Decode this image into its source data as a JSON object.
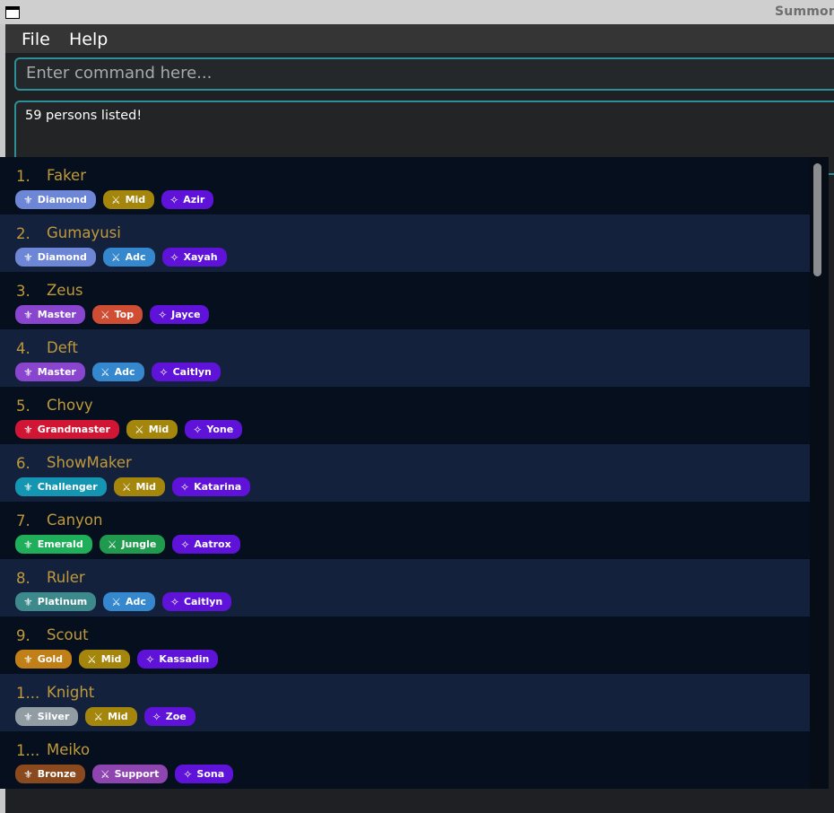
{
  "window": {
    "title": "Summon"
  },
  "menu": [
    {
      "label": "File"
    },
    {
      "label": "Help"
    }
  ],
  "command": {
    "placeholder": "Enter command here...",
    "value": ""
  },
  "result": {
    "text": "59 persons listed!"
  },
  "icons": {
    "rank": "fleur-de-lis-icon",
    "role": "crossed-swords-icon",
    "champion": "sparkle-icon"
  },
  "colors": {
    "rank": {
      "Diamond": "#6d86d6",
      "Master": "#8a45cf",
      "Grandmaster": "#d01535",
      "Challenger": "#1496b3",
      "Emerald": "#1fae5a",
      "Platinum": "#3c8a8c",
      "Gold": "#c17f17",
      "Silver": "#929da3",
      "Bronze": "#8a4a1d"
    },
    "role": {
      "Mid": "#a4860d",
      "Adc": "#3688ce",
      "Top": "#cf4d33",
      "Jungle": "#209a4f",
      "Support": "#8e45b0"
    },
    "champion": "#5f12d8",
    "name_text": "#c09a3a",
    "accent_border": "#2f8f98"
  },
  "persons": [
    {
      "index": "1.",
      "name": "Faker",
      "rank": "Diamond",
      "role": "Mid",
      "champion": "Azir"
    },
    {
      "index": "2.",
      "name": "Gumayusi",
      "rank": "Diamond",
      "role": "Adc",
      "champion": "Xayah"
    },
    {
      "index": "3.",
      "name": "Zeus",
      "rank": "Master",
      "role": "Top",
      "champion": "Jayce"
    },
    {
      "index": "4.",
      "name": "Deft",
      "rank": "Master",
      "role": "Adc",
      "champion": "Caitlyn"
    },
    {
      "index": "5.",
      "name": "Chovy",
      "rank": "Grandmaster",
      "role": "Mid",
      "champion": "Yone"
    },
    {
      "index": "6.",
      "name": "ShowMaker",
      "rank": "Challenger",
      "role": "Mid",
      "champion": "Katarina"
    },
    {
      "index": "7.",
      "name": "Canyon",
      "rank": "Emerald",
      "role": "Jungle",
      "champion": "Aatrox"
    },
    {
      "index": "8.",
      "name": "Ruler",
      "rank": "Platinum",
      "role": "Adc",
      "champion": "Caitlyn"
    },
    {
      "index": "9.",
      "name": "Scout",
      "rank": "Gold",
      "role": "Mid",
      "champion": "Kassadin"
    },
    {
      "index": "1...",
      "name": "Knight",
      "rank": "Silver",
      "role": "Mid",
      "champion": "Zoe"
    },
    {
      "index": "1...",
      "name": "Meiko",
      "rank": "Bronze",
      "role": "Support",
      "champion": "Sona"
    }
  ]
}
